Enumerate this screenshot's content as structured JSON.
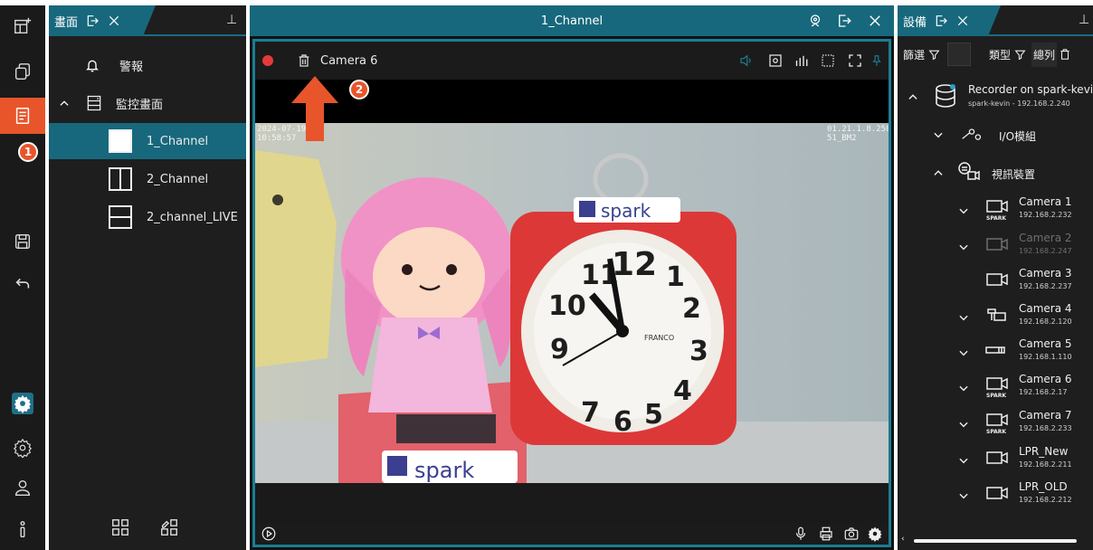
{
  "left_panel": {
    "tab_label": "畫面",
    "items": [
      {
        "label": "警報"
      },
      {
        "label": "監控畫面"
      },
      {
        "label": "1_Channel"
      },
      {
        "label": "2_Channel"
      },
      {
        "label": "2_channel_LIVE"
      }
    ]
  },
  "center": {
    "title": "1_Channel",
    "camera_label": "Camera 6",
    "osd_left_line1": "2024-07-19",
    "osd_left_line2": "10:58:57",
    "osd_right_line1": "01.21.1.8.250",
    "osd_right_line2": "51_BM2"
  },
  "right_panel": {
    "tab_label": "設備",
    "filter_label": "篩選",
    "type_label": "類型",
    "total_label": "總列",
    "recorder_name": "Recorder on spark-kevin",
    "recorder_sub": "spark-kevin - 192.168.2.240",
    "io_group": "I/O模組",
    "video_group": "視訊裝置",
    "devices": [
      {
        "name": "Camera 1",
        "ip": "192.168.2.232",
        "brand": "SPARK"
      },
      {
        "name": "Camera 2",
        "ip": "192.168.2.247",
        "brand": ""
      },
      {
        "name": "Camera 3",
        "ip": "192.168.2.237",
        "brand": ""
      },
      {
        "name": "Camera 4",
        "ip": "192.168.2.120",
        "brand": ""
      },
      {
        "name": "Camera 5",
        "ip": "192.168.1.110",
        "brand": ""
      },
      {
        "name": "Camera 6",
        "ip": "192.168.2.17",
        "brand": "SPARK"
      },
      {
        "name": "Camera 7",
        "ip": "192.168.2.233",
        "brand": "SPARK"
      },
      {
        "name": "LPR_New",
        "ip": "192.168.2.211",
        "brand": ""
      },
      {
        "name": "LPR_OLD",
        "ip": "192.168.2.212",
        "brand": ""
      }
    ]
  },
  "annotations": {
    "badge1": "1",
    "badge2": "2"
  },
  "scene": {
    "bear_logo": "spark",
    "clock_logo": "spark",
    "clock_brand": "FRANCO"
  },
  "colors": {
    "accent": "#17687c",
    "highlight": "#e8552b",
    "rail": "#1a1a1a",
    "panel": "#1e1e1e"
  }
}
